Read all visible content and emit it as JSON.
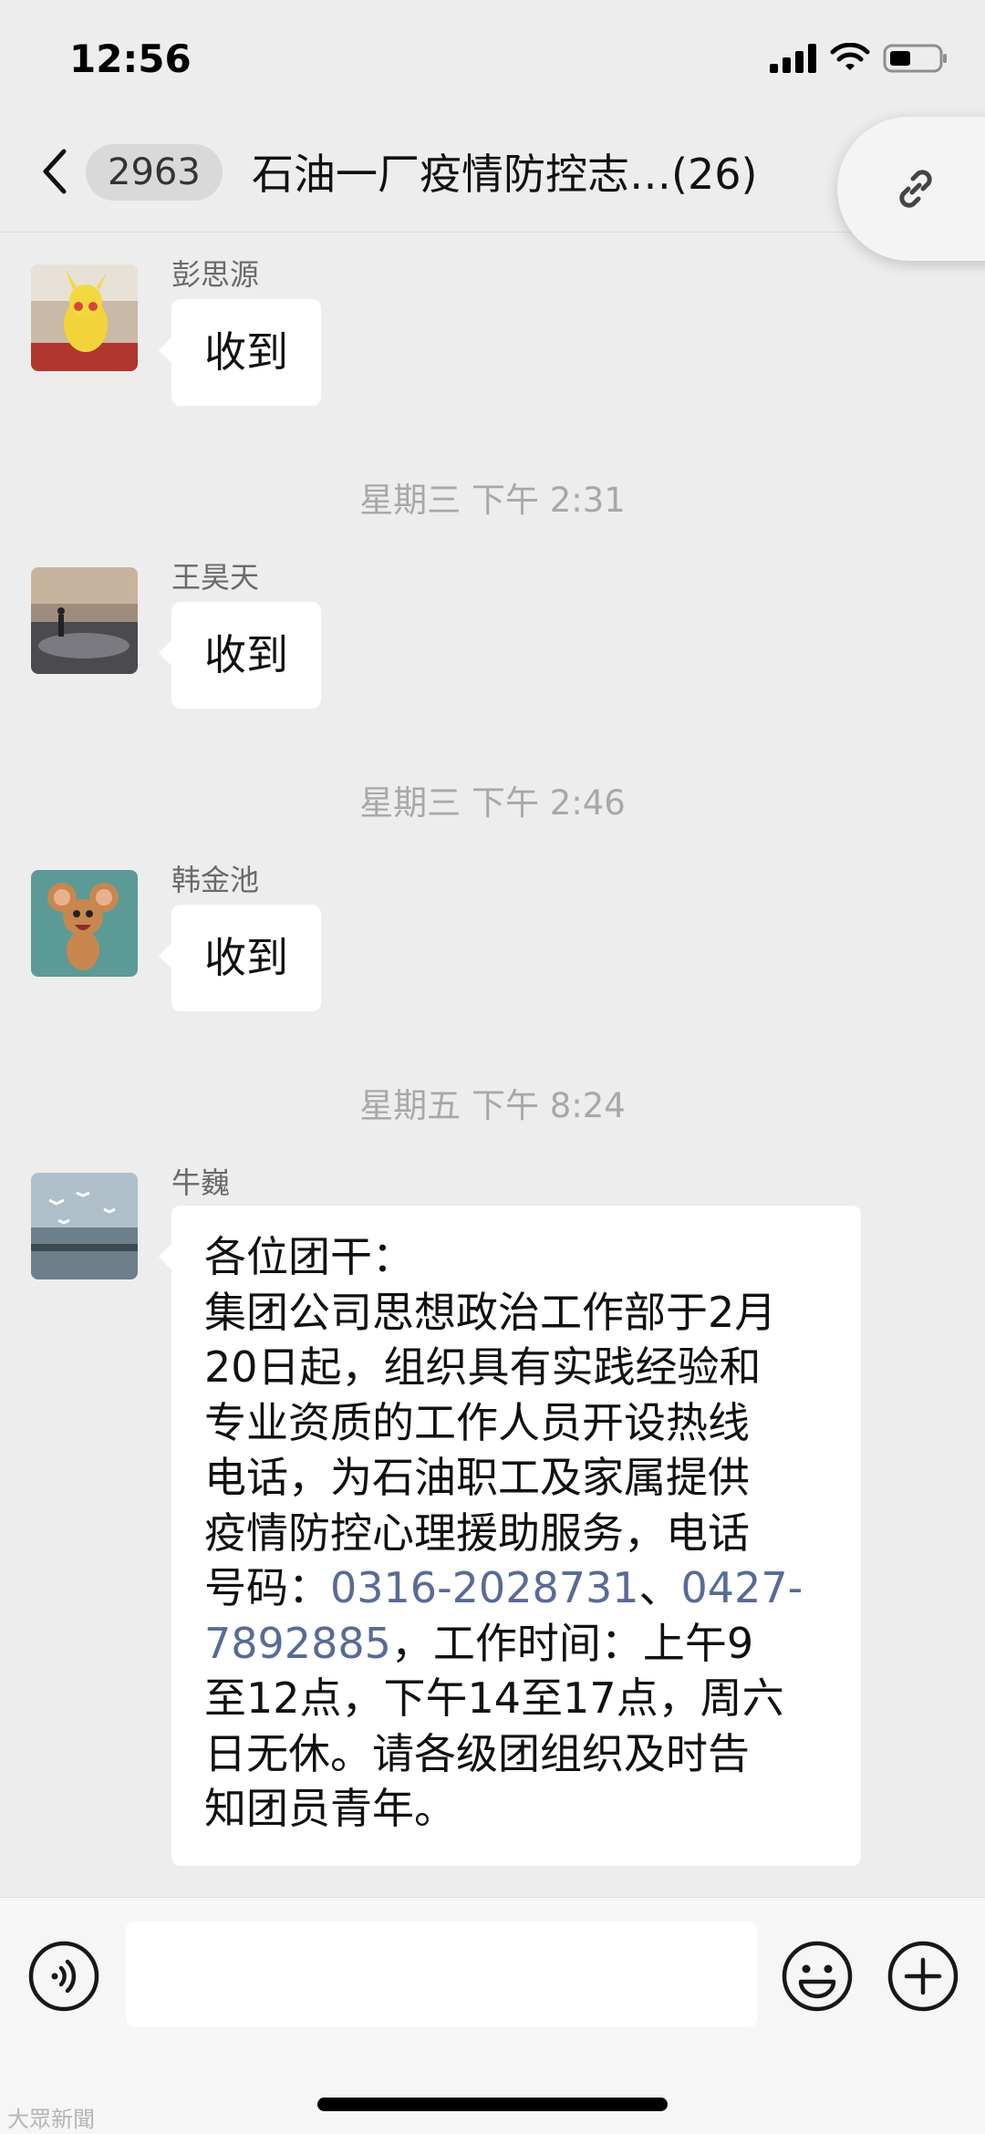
{
  "status_bar": {
    "time": "12:56"
  },
  "header": {
    "unread_count": "2963",
    "title": "石油一厂疫情防控志…",
    "member_count": "(26)"
  },
  "messages": [
    {
      "sender": "彭思源",
      "text": "收到"
    },
    {
      "timestamp": "星期三 下午 2:31"
    },
    {
      "sender": "王昊天",
      "text": "收到"
    },
    {
      "timestamp": "星期三 下午 2:46"
    },
    {
      "sender": "韩金池",
      "text": "收到"
    },
    {
      "timestamp": "星期五 下午 8:24"
    },
    {
      "sender": "牛巍",
      "lines": [
        "各位团干：",
        "集团公司思想政治工作部于2月",
        "20日起，组织具有实践经验和",
        "专业资质的工作人员开设热线",
        "电话，为石油职工及家属提供",
        "疫情防控心理援助服务，电话"
      ],
      "line7_prefix": "号码：",
      "phone1": "0316-2028731",
      "line7_sep": "、",
      "phone2_part1": "0427-",
      "phone2_part2": "7892885",
      "line8_suffix": "，工作时间：上午9",
      "lines_after": [
        "至12点，下午14至17点，周六",
        "日无休。请各级团组织及时告",
        "知团员青年。"
      ]
    }
  ],
  "input": {
    "placeholder": ""
  },
  "watermark": "大眾新聞",
  "colors": {
    "background": "#ededed",
    "bubble": "#ffffff",
    "link_text": "#576b95",
    "timestamp": "#a8a8a8"
  },
  "icons": [
    "signal-icon",
    "wifi-icon",
    "battery-icon",
    "back-arrow-icon",
    "link-icon",
    "voice-icon",
    "emoji-icon",
    "plus-icon"
  ]
}
